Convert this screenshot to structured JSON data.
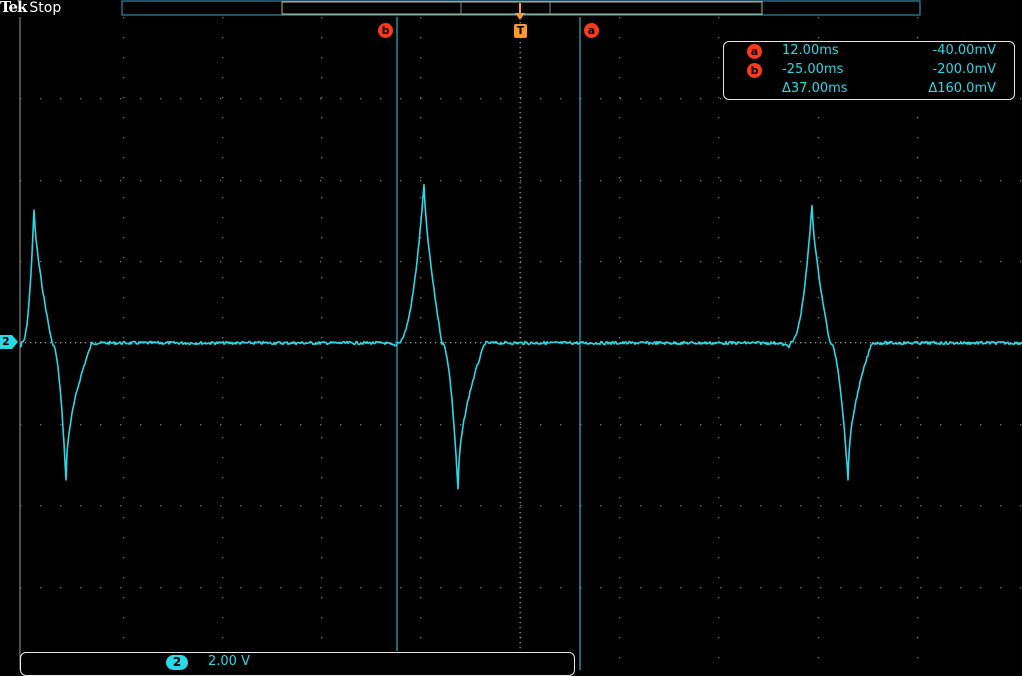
{
  "header": {
    "brand": "Tek",
    "state": "Stop"
  },
  "cursors": {
    "a_symbol": "a",
    "b_symbol": "b",
    "trigger_symbol": "T"
  },
  "readout": {
    "a": {
      "time": "12.00ms",
      "volt": "-40.00mV"
    },
    "b": {
      "time": "-25.00ms",
      "volt": "-200.0mV"
    },
    "delta": {
      "time": "Δ37.00ms",
      "volt": "Δ160.0mV"
    }
  },
  "channel": {
    "number": "2",
    "scale": "2.00 V"
  },
  "colors": {
    "trace": "#2bd8e8",
    "cursor_badge": "#ff3a1a",
    "trigger": "#ff9b2e",
    "grid": "#9a9a9a",
    "frame": "#e8e8e8"
  },
  "icons": {
    "cursor_a": "circle-a-icon",
    "cursor_b": "circle-b-icon",
    "trigger": "trigger-T-icon",
    "channel_ground": "channel-2-ground-marker-icon"
  }
}
